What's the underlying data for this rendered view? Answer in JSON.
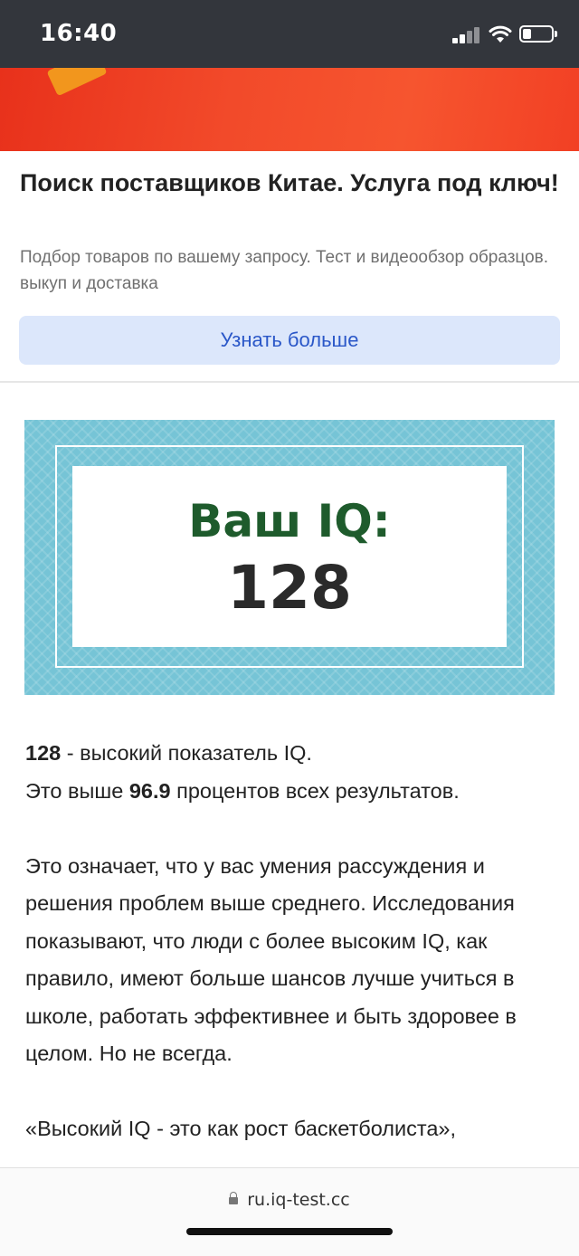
{
  "status_bar": {
    "time": "16:40"
  },
  "ad": {
    "title": "Поиск поставщиков Китае. Услуга под ключ!",
    "description": "Подбор товаров по вашему запросу. Тест и видеообзор образцов. выкуп и доставка",
    "button_label": "Узнать больше"
  },
  "iq_card": {
    "label": "Ваш IQ:",
    "value": "128"
  },
  "article": {
    "line1_bold": "128",
    "line1_rest": " - высокий показатель IQ.",
    "line2_pre": "Это выше ",
    "line2_bold": "96.9",
    "line2_post": " процентов всех результатов.",
    "paragraph2": "Это означает, что у вас умения рассуждения и решения проблем выше среднего. Исследования показывают, что люди с более высоким IQ, как правило, имеют больше шансов лучше учиться в школе, работать эффективнее и быть здоровее в целом. Но не всегда.",
    "paragraph3": "«Высокий IQ - это как рост баскетболиста»,"
  },
  "browser": {
    "url": "ru.iq-test.cc"
  },
  "colors": {
    "status_bar_bg": "#33363c",
    "ad_button_bg": "#dce7fb",
    "ad_button_text": "#2a57c8",
    "card_bg": "#76c4d6",
    "iq_label": "#1e5b2c"
  }
}
